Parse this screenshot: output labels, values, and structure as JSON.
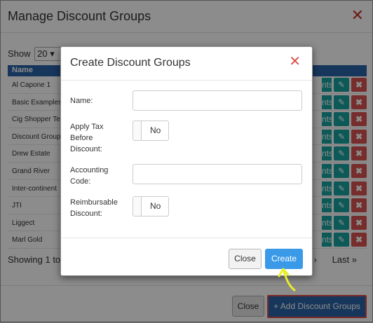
{
  "background": {
    "title": "Manage Discount Groups",
    "close_glyph": "✕",
    "show_label": "Show",
    "page_size": "20",
    "column_name": "Name",
    "rows": [
      "Al Capone 1",
      "Basic Examples",
      "Cig Shopper Te",
      "Discount Group",
      "Drew Estate",
      "Grand River",
      "Inter-continent",
      "JTI",
      "Liggect",
      "Marl Gold"
    ],
    "row_action_partial": "nts",
    "showing_text": "Showing 1 to 1",
    "pager_next": "›",
    "pager_last": "Last »",
    "close_label": "Close",
    "add_label": "+ Add Discount Groups"
  },
  "dialog": {
    "title": "Create Discount Groups",
    "close_glyph": "✕",
    "fields": {
      "name_label": "Name:",
      "name_value": "",
      "apply_tax_label": "Apply Tax Before Discount:",
      "apply_tax_value": "No",
      "accounting_label": "Accounting Code:",
      "accounting_value": "",
      "reimbursable_label": "Reimbursable Discount:",
      "reimbursable_value": "No"
    },
    "close_label": "Close",
    "create_label": "Create"
  },
  "icons": {
    "edit": "pencil-icon",
    "delete": "delete-icon"
  },
  "colors": {
    "header_blue": "#2a63a6",
    "teal": "#17a2a0",
    "danger": "#d9534f",
    "create_blue": "#3a9ae8",
    "annotation": "#e8ef2a"
  }
}
